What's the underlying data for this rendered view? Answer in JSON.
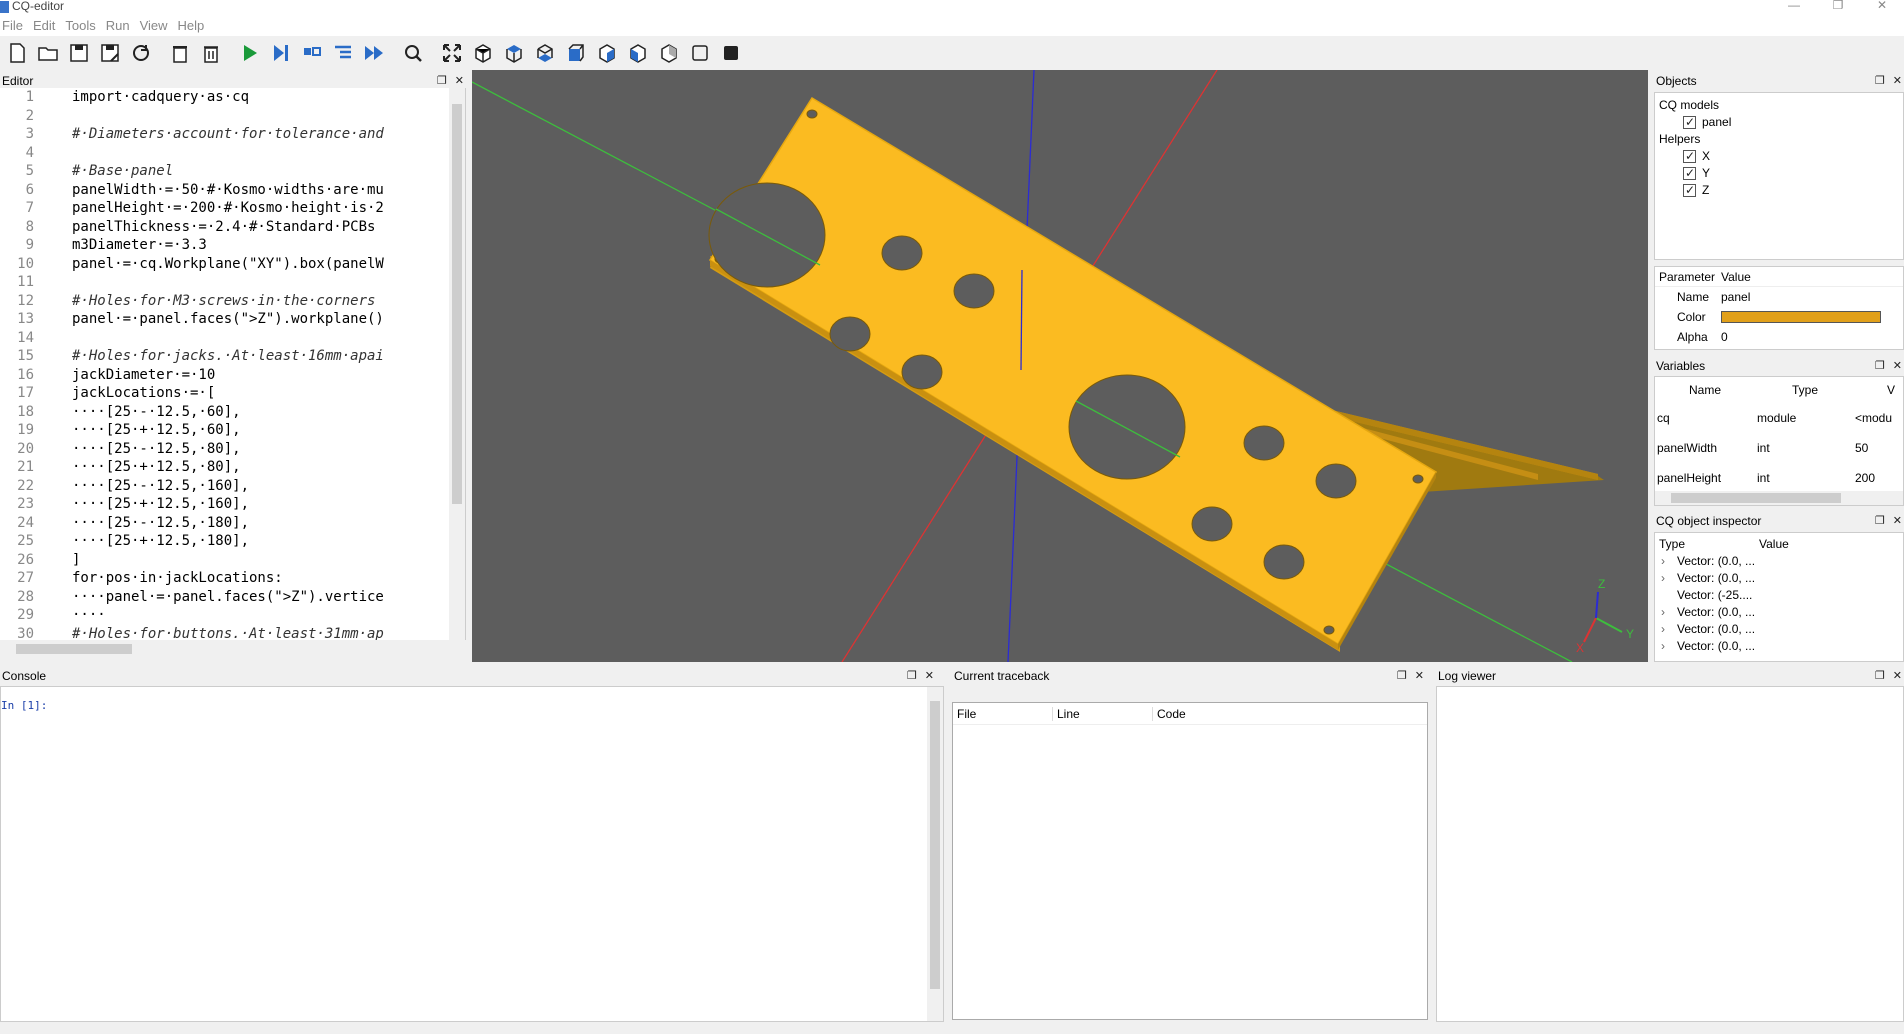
{
  "window": {
    "title": "CQ-editor",
    "controls": [
      "—",
      "❐",
      "✕"
    ]
  },
  "menu": [
    "File",
    "Edit",
    "Tools",
    "Run",
    "View",
    "Help"
  ],
  "toolbar_icons": [
    "new-file-icon",
    "open-file-icon",
    "save-icon",
    "save-as-icon",
    "reload-icon",
    "clear-icon",
    "delete-icon",
    "run-icon",
    "debug-icon",
    "step-icon",
    "step-in-icon",
    "continue-icon",
    "inspect-icon",
    "fit-view-icon",
    "iso-view-icon",
    "top-view-icon",
    "bottom-view-icon",
    "front-view-icon",
    "back-view-icon",
    "left-view-icon",
    "right-view-icon",
    "wireframe-icon",
    "shaded-icon"
  ],
  "editor": {
    "title": "Editor",
    "line_numbers": [
      "1",
      "2",
      "3",
      "4",
      "5",
      "6",
      "7",
      "8",
      "9",
      "10",
      "11",
      "12",
      "13",
      "14",
      "15",
      "16",
      "17",
      "18",
      "19",
      "20",
      "21",
      "22",
      "23",
      "24",
      "25",
      "26",
      "27",
      "28",
      "29",
      "30"
    ],
    "lines": [
      "import·cadquery·as·cq",
      "",
      "#·Diameters·account·for·tolerance·and",
      "",
      "#·Base·panel",
      "panelWidth·=·50·#·Kosmo·widths·are·mu",
      "panelHeight·=·200·#·Kosmo·height·is·2",
      "panelThickness·=·2.4·#·Standard·PCBs",
      "m3Diameter·=·3.3",
      "panel·=·cq.Workplane(\"XY\").box(panelW",
      "",
      "#·Holes·for·M3·screws·in·the·corners",
      "panel·=·panel.faces(\">Z\").workplane()",
      "",
      "#·Holes·for·jacks.·At·least·16mm·apai",
      "jackDiameter·=·10",
      "jackLocations·=·[",
      "····[25·-·12.5,·60],",
      "····[25·+·12.5,·60],",
      "····[25·-·12.5,·80],",
      "····[25·+·12.5,·80],",
      "····[25·-·12.5,·160],",
      "····[25·+·12.5,·160],",
      "····[25·-·12.5,·180],",
      "····[25·+·12.5,·180],",
      "]",
      "for·pos·in·jackLocations:",
      "····panel·=·panel.faces(\">Z\").vertice",
      "····",
      "#·Holes·for·buttons.·At·least·31mm·ap"
    ]
  },
  "viewport": {
    "panel_color": "#fbbb21",
    "axis_labels": {
      "x": "X",
      "y": "Y",
      "z": "Z"
    }
  },
  "objects": {
    "title": "Objects",
    "groups": [
      {
        "label": "CQ models",
        "items": [
          "panel"
        ]
      },
      {
        "label": "Helpers",
        "items": [
          "X",
          "Y",
          "Z"
        ]
      }
    ]
  },
  "properties": {
    "headers": [
      "Parameter",
      "Value"
    ],
    "rows": [
      {
        "name": "Name",
        "value": "panel"
      },
      {
        "name": "Color",
        "value": "#e1a01a"
      },
      {
        "name": "Alpha",
        "value": "0"
      }
    ]
  },
  "variables": {
    "title": "Variables",
    "headers": [
      "Name",
      "Type",
      "V"
    ],
    "rows": [
      {
        "name": "cq",
        "type": "module",
        "value": "<modu"
      },
      {
        "name": "panelWidth",
        "type": "int",
        "value": "50"
      },
      {
        "name": "panelHeight",
        "type": "int",
        "value": "200"
      }
    ]
  },
  "inspector": {
    "title": "CQ object inspector",
    "headers": [
      "Type",
      "Value"
    ],
    "rows": [
      "Vector: (0.0, ...",
      "Vector: (0.0, ...",
      "Vector: (-25....",
      "Vector: (0.0, ...",
      "Vector: (0.0, ...",
      "Vector: (0.0, ..."
    ]
  },
  "console": {
    "title": "Console",
    "prompt": "In [1]:"
  },
  "traceback": {
    "title": "Current traceback",
    "headers": [
      "File",
      "Line",
      "Code"
    ]
  },
  "log": {
    "title": "Log viewer"
  }
}
